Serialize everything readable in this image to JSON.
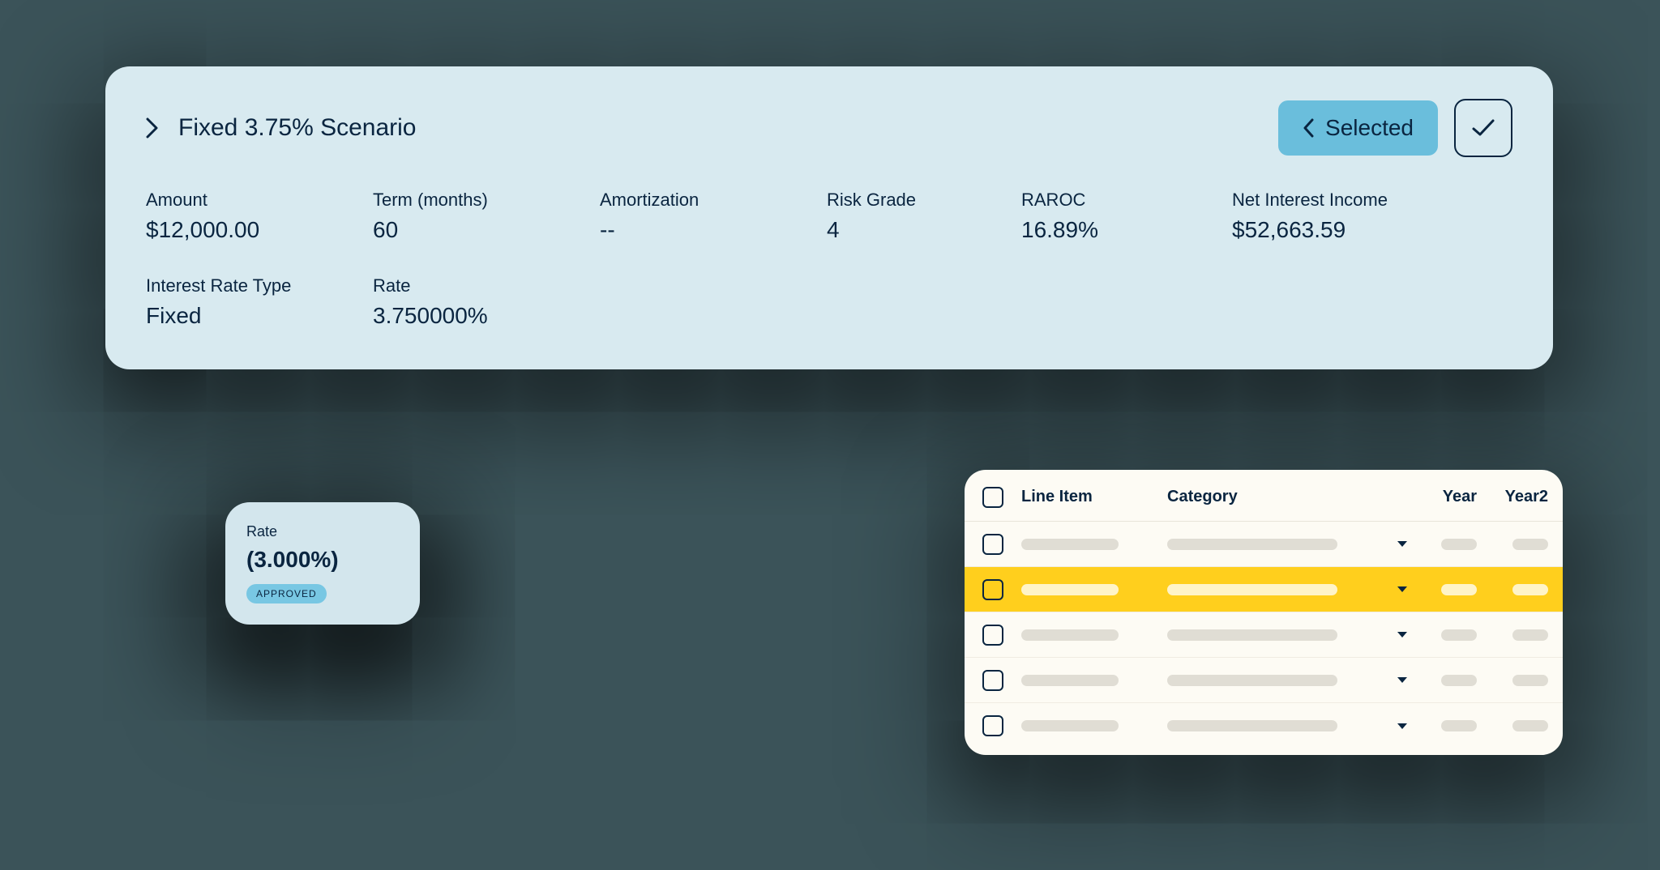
{
  "scenario": {
    "title": "Fixed 3.75% Scenario",
    "selected_label": "Selected",
    "metrics": {
      "amount": {
        "label": "Amount",
        "value": "$12,000.00"
      },
      "term": {
        "label": "Term (months)",
        "value": "60"
      },
      "amortization": {
        "label": "Amortization",
        "value": "--"
      },
      "risk_grade": {
        "label": "Risk Grade",
        "value": "4"
      },
      "raroc": {
        "label": "RAROC",
        "value": "16.89%"
      },
      "nii": {
        "label": "Net Interest Income",
        "value": "$52,663.59"
      },
      "rate_type": {
        "label": "Interest Rate Type",
        "value": "Fixed"
      },
      "rate": {
        "label": "Rate",
        "value": "3.750000%"
      }
    }
  },
  "rate_card": {
    "label": "Rate",
    "value": "(3.000%)",
    "badge": "APPROVED"
  },
  "table": {
    "headers": {
      "line_item": "Line Item",
      "category": "Category",
      "year": "Year",
      "year2": "Year2"
    },
    "rows": [
      {
        "highlighted": false
      },
      {
        "highlighted": true
      },
      {
        "highlighted": false
      },
      {
        "highlighted": false
      },
      {
        "highlighted": false
      }
    ]
  },
  "colors": {
    "card_bg": "#d8eaf0",
    "accent": "#6abedc",
    "highlight": "#ffcf1d",
    "text": "#0a2540"
  }
}
